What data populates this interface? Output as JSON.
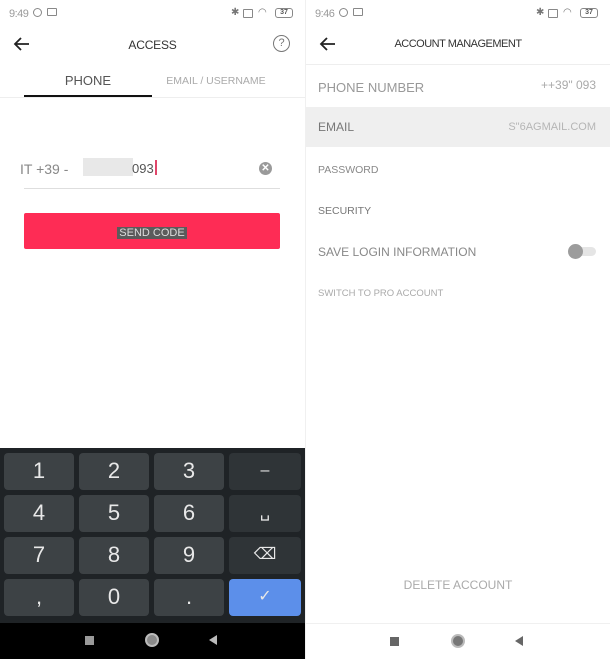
{
  "left_screen": {
    "status_bar": {
      "time": "9:49",
      "battery": "37",
      "icons_left": [
        "alarm-icon",
        "message-icon"
      ],
      "icons_right": [
        "bluetooth-icon",
        "screen-icon",
        "wifi-icon",
        "battery-icon"
      ]
    },
    "app_bar": {
      "title": "ACCESS",
      "back_icon": "arrow-left-icon",
      "help_icon_glyph": "?"
    },
    "tabs": [
      {
        "label": "PHONE",
        "active": true
      },
      {
        "label": "EMAIL / USERNAME",
        "active": false
      }
    ],
    "phone_input": {
      "country_code": "IT +39 -",
      "value_suffix": "093",
      "clear_glyph": "✕"
    },
    "send_button": {
      "label": "SEND CODE"
    },
    "keyboard": {
      "rows": [
        [
          "1",
          "2",
          "3",
          "–"
        ],
        [
          "4",
          "5",
          "6",
          "␣"
        ],
        [
          "7",
          "8",
          "9",
          "⌫"
        ],
        [
          ",",
          "0",
          ".",
          "✓"
        ]
      ]
    }
  },
  "right_screen": {
    "status_bar": {
      "time": "9:46",
      "battery": "37"
    },
    "app_bar": {
      "title": "ACCOUNT MANAGEMENT",
      "back_icon": "arrow-left-icon"
    },
    "rows": [
      {
        "label": "PHONE NUMBER",
        "value": "++39\" 093"
      },
      {
        "label": "EMAIL",
        "value": "S\"6AGMAIL.COM",
        "highlighted": true
      },
      {
        "label": "PASSWORD",
        "value": ""
      },
      {
        "label": "SECURITY",
        "value": ""
      },
      {
        "label": "SAVE LOGIN INFORMATION",
        "toggle": false
      },
      {
        "label": "SWITCH TO PRO ACCOUNT",
        "value": ""
      }
    ],
    "delete_account": "DELETE ACCOUNT"
  },
  "colors": {
    "accent": "#fe2c55",
    "keyboard_enter": "#5c8fea",
    "keyboard_bg": "#1f2326",
    "key_bg": "#3d4245"
  }
}
